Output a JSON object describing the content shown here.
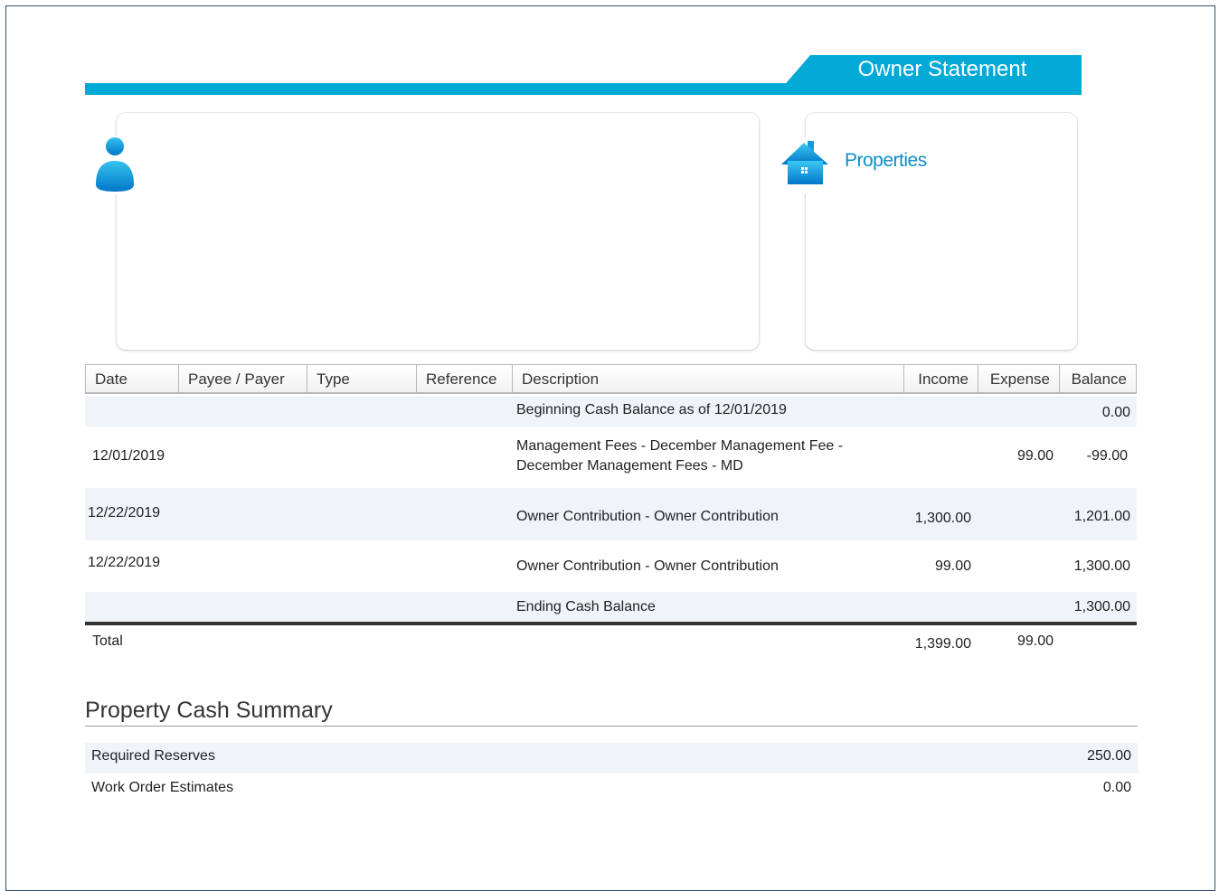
{
  "header": {
    "title": "Owner Statement"
  },
  "properties_card": {
    "title": "Properties"
  },
  "table": {
    "columns": [
      "Date",
      "Payee / Payer",
      "Type",
      "Reference",
      "Description",
      "Income",
      "Expense",
      "Balance"
    ],
    "rows": [
      {
        "date": "",
        "payee": "",
        "type": "",
        "reference": "",
        "description": "Beginning Cash Balance as of 12/01/2019",
        "income": "",
        "expense": "",
        "balance": "0.00"
      },
      {
        "date": "12/01/2019",
        "payee": "",
        "type": "",
        "reference": "",
        "description": "Management Fees - December Management Fee - December Management Fees - MD",
        "income": "",
        "expense": "99.00",
        "balance": "-99.00"
      },
      {
        "date": "12/22/2019",
        "payee": "",
        "type": "",
        "reference": "",
        "description": "Owner Contribution - Owner Contribution",
        "income": "1,300.00",
        "expense": "",
        "balance": "1,201.00"
      },
      {
        "date": "12/22/2019",
        "payee": "",
        "type": "",
        "reference": "",
        "description": "Owner Contribution - Owner Contribution",
        "income": "99.00",
        "expense": "",
        "balance": "1,300.00"
      },
      {
        "date": "",
        "payee": "",
        "type": "",
        "reference": "",
        "description": "Ending Cash Balance",
        "income": "",
        "expense": "",
        "balance": "1,300.00"
      }
    ],
    "total": {
      "label": "Total",
      "income": "1,399.00",
      "expense": "99.00"
    }
  },
  "cash_summary": {
    "title": "Property Cash Summary",
    "rows": [
      {
        "label": "Required Reserves",
        "value": "250.00"
      },
      {
        "label": "Work Order Estimates",
        "value": "0.00"
      }
    ]
  },
  "colors": {
    "accent": "#00a9d6",
    "link": "#0b8fc7",
    "row_shade": "#eef4f9"
  },
  "icons": {
    "owner": "person-icon",
    "properties": "house-icon"
  }
}
